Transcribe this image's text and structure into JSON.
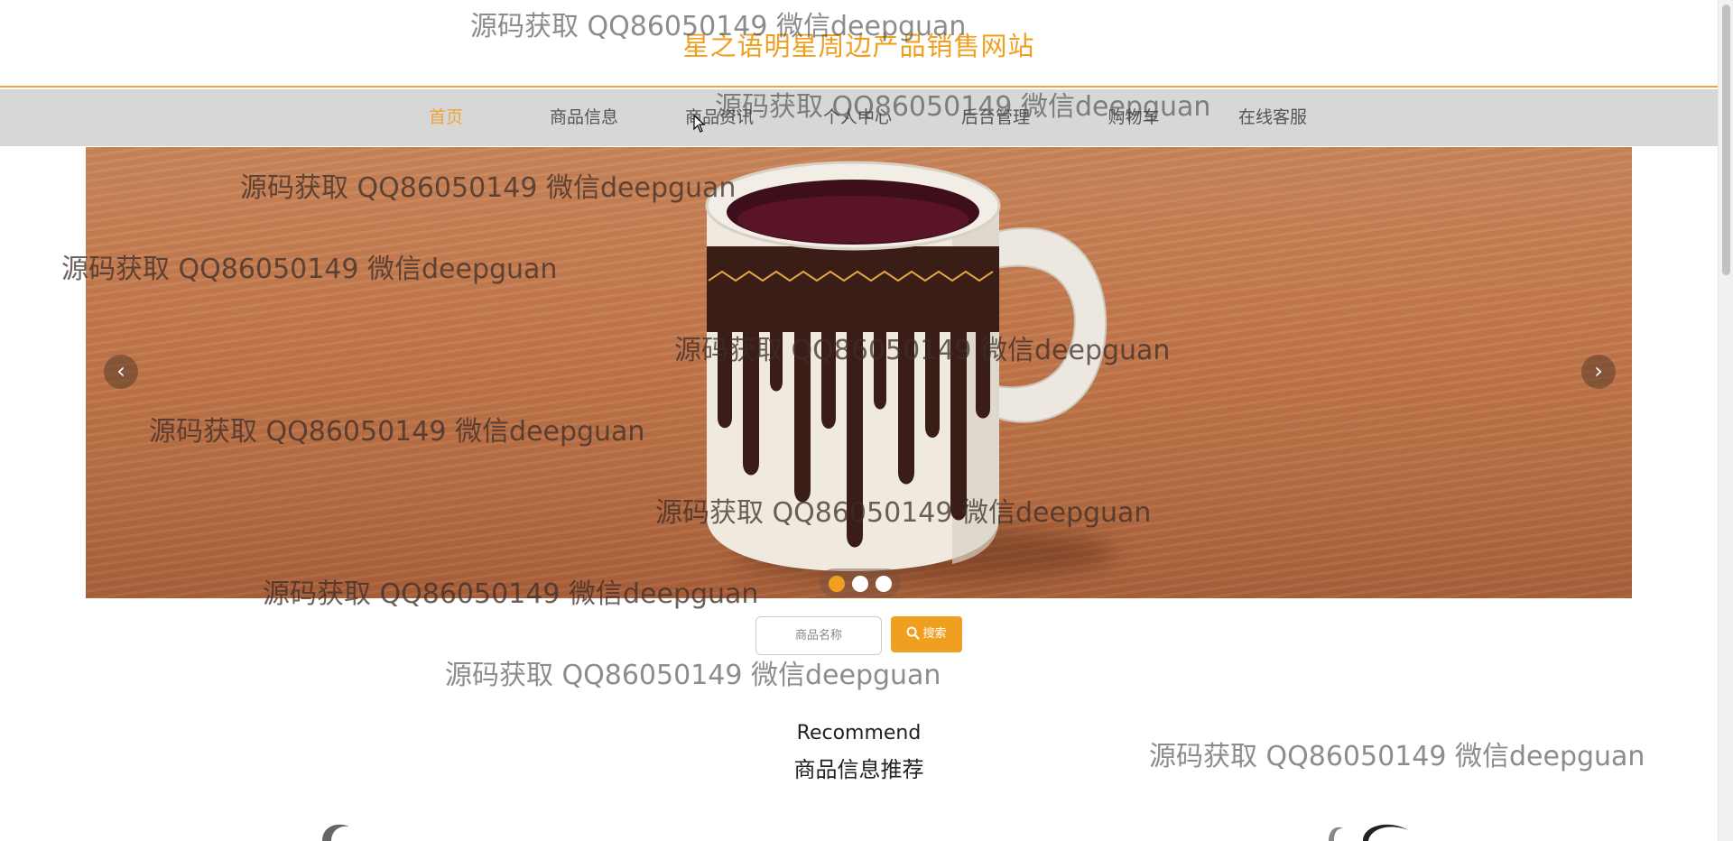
{
  "site": {
    "title": "星之语明星周边产品销售网站"
  },
  "nav": {
    "items": [
      {
        "label": "首页",
        "active": true
      },
      {
        "label": "商品信息",
        "active": false
      },
      {
        "label": "商品资讯",
        "active": false
      },
      {
        "label": "个人中心",
        "active": false
      },
      {
        "label": "后台管理",
        "active": false
      },
      {
        "label": "购物车",
        "active": false
      },
      {
        "label": "在线客服",
        "active": false
      }
    ]
  },
  "carousel": {
    "slide_count": 3,
    "active_index": 0,
    "prev_icon": "chevron-left-icon",
    "next_icon": "chevron-right-icon",
    "prev_glyph": "‹",
    "next_glyph": "›"
  },
  "search": {
    "placeholder": "商品名称",
    "button_label": "搜索",
    "button_icon": "search-icon"
  },
  "recommend": {
    "title_en": "Recommend",
    "title_cn": "商品信息推荐"
  },
  "watermark": {
    "text": "源码获取 QQ86050149 微信deepguan"
  },
  "colors": {
    "accent": "#f0a020",
    "nav_bg": "#d7d7d7",
    "header_border": "#f0a53a"
  }
}
